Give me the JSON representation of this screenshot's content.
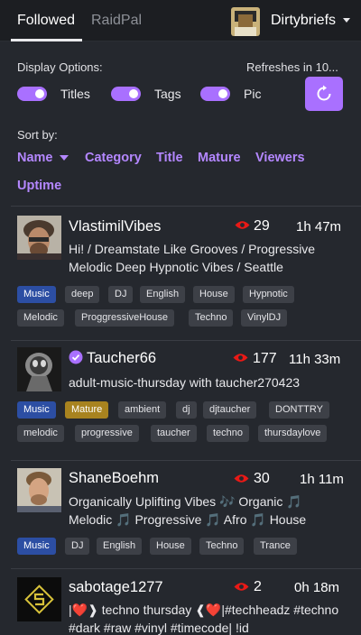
{
  "header": {
    "tabs": [
      {
        "label": "Followed"
      },
      {
        "label": "RaidPal"
      }
    ],
    "user": {
      "name": "Dirtybriefs"
    }
  },
  "options": {
    "display_label": "Display Options:",
    "refresh_label": "Refreshes in 10...",
    "toggles": [
      {
        "label": "Titles",
        "on": true
      },
      {
        "label": "Tags",
        "on": true
      },
      {
        "label": "Pic",
        "on": true
      }
    ]
  },
  "sort": {
    "label": "Sort by:",
    "options": [
      "Name",
      "Category",
      "Title",
      "Mature",
      "Viewers",
      "Uptime"
    ]
  },
  "streams": [
    {
      "name": "VlastimilVibes",
      "viewers": "29",
      "uptime": "1h 47m",
      "title": "Hi! / Dreamstate Like Grooves / Progressive Melodic Deep Hypnotic Vibes / Seattle",
      "tags": [
        "Music",
        "deep",
        "DJ",
        "English",
        "House",
        "Hypnotic",
        "Melodic",
        "ProggressiveHouse",
        "Techno",
        "VinylDJ"
      ]
    },
    {
      "name": "Taucher66",
      "viewers": "177",
      "uptime": "11h 33m",
      "title": "adult-music-thursday with taucher270423",
      "tags": [
        "Music",
        "Mature",
        "ambient",
        "dj",
        "djtaucher",
        "DONTTRY",
        "melodic",
        "progressive",
        "taucher",
        "techno",
        "thursdaylove"
      ]
    },
    {
      "name": "ShaneBoehm",
      "viewers": "30",
      "uptime": "1h 11m",
      "title": "Organically Uplifting Vibes 🎶 Organic 🎵 Melodic 🎵 Progressive 🎵 Afro 🎵 House",
      "tags": [
        "Music",
        "DJ",
        "English",
        "House",
        "Techno",
        "Trance"
      ]
    },
    {
      "name": "sabotage1277",
      "viewers": "2",
      "uptime": "0h 18m",
      "title": "|❤️❱ techno thursday ❰❤️|#techheadz #techno #dark #raw #vinyl #timecode| !id",
      "tags": []
    }
  ],
  "colors": {
    "accent": "#a970ff",
    "category_tag": "#2c4ea3",
    "mature_tag": "#a8831f",
    "live_eye": "#e91916"
  }
}
